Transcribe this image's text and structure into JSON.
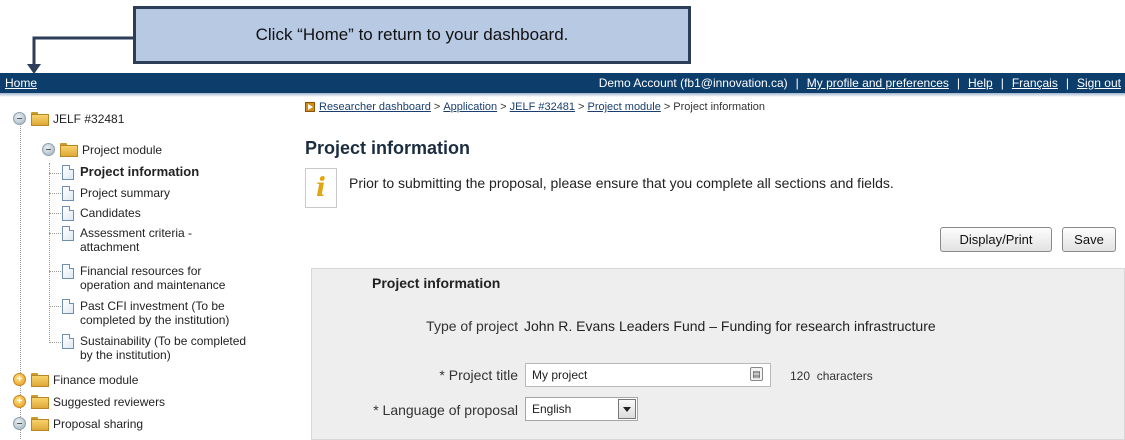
{
  "callout": {
    "text": "Click “Home” to return to your dashboard."
  },
  "topbar": {
    "home": "Home",
    "account": "Demo Account (fb1@innovation.ca)",
    "separator": "|",
    "links": [
      "My profile and preferences",
      "Help",
      "Français",
      "Sign out"
    ]
  },
  "tree": {
    "root": "JELF #32481",
    "project_module": "Project module",
    "items": [
      "Project information",
      "Project summary",
      "Candidates",
      "Assessment criteria - attachment",
      "Financial resources for operation and maintenance",
      "Past CFI investment (To be completed by the institution)",
      "Sustainability (To be completed by the institution)"
    ],
    "items_wrapped": [
      [
        "Project information"
      ],
      [
        "Project summary"
      ],
      [
        "Candidates"
      ],
      [
        "Assessment criteria -",
        "attachment"
      ],
      [
        "Financial resources for",
        "operation and maintenance"
      ],
      [
        "Past CFI investment (To be",
        "completed by the institution)"
      ],
      [
        "Sustainability (To be completed",
        "by the institution)"
      ]
    ],
    "finance_module": "Finance module",
    "suggested_reviewers": "Suggested reviewers",
    "proposal_sharing": "Proposal sharing"
  },
  "breadcrumb": {
    "links": [
      "Researcher dashboard",
      "Application",
      "JELF #32481",
      "Project module"
    ],
    "current": "Project information",
    "sep": ">"
  },
  "main": {
    "title": "Project information",
    "info": "Prior to submitting the proposal, please ensure that you complete all sections and fields.",
    "display_print": "Display/Print",
    "save": "Save"
  },
  "panel": {
    "title": "Project information",
    "type_label": "Type of project",
    "type_value": "John R. Evans Leaders Fund – Funding for research infrastructure",
    "title_label": "* Project title",
    "title_value": "My project",
    "char_count": "120",
    "char_unit": "characters",
    "language_label": "* Language of proposal",
    "language_value": "English"
  }
}
